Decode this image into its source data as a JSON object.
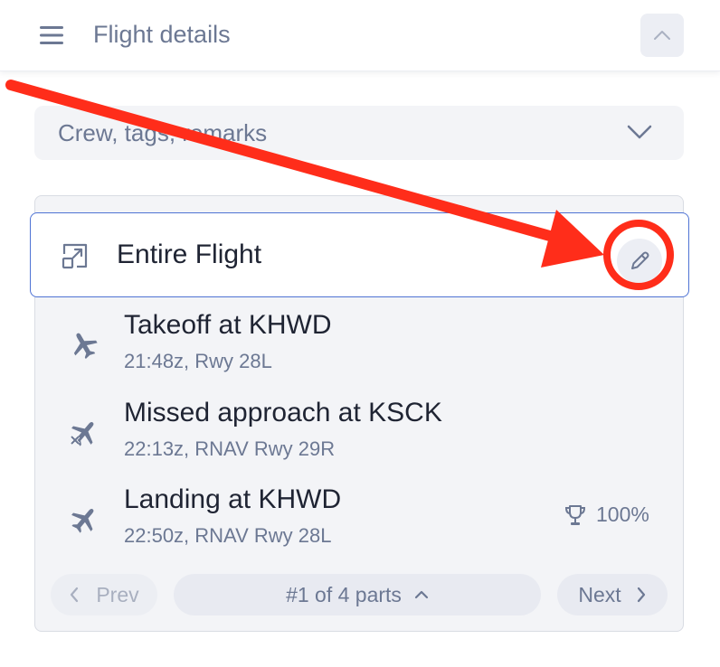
{
  "header": {
    "title": "Flight details",
    "menu_icon": "hamburger-menu-icon",
    "collapse_icon": "chevron-up-icon"
  },
  "crew_panel": {
    "label": "Crew, tags, remarks",
    "icon": "chevron-down-icon"
  },
  "entire_flight": {
    "label": "Entire Flight",
    "icon": "expand-icon",
    "edit_icon": "pencil-icon"
  },
  "events": [
    {
      "title": "Takeoff at KHWD",
      "subtitle": "21:48z, Rwy 28L",
      "icon": "takeoff-plane-icon"
    },
    {
      "title": "Missed approach at KSCK",
      "subtitle": "22:13z, RNAV Rwy 29R",
      "icon": "missed-approach-plane-icon"
    },
    {
      "title": "Landing at KHWD",
      "subtitle": "22:50z, RNAV Rwy 28L",
      "icon": "landing-plane-icon",
      "score": "100%",
      "score_icon": "trophy-icon"
    }
  ],
  "pager": {
    "prev_label": "Prev",
    "current_label": "#1 of 4 parts",
    "next_label": "Next"
  },
  "annotation": {
    "color": "#ff2d1a"
  },
  "colors": {
    "accent_border": "#4f73d4",
    "muted_text": "#6c7893",
    "panel_bg": "#f3f4f7"
  }
}
